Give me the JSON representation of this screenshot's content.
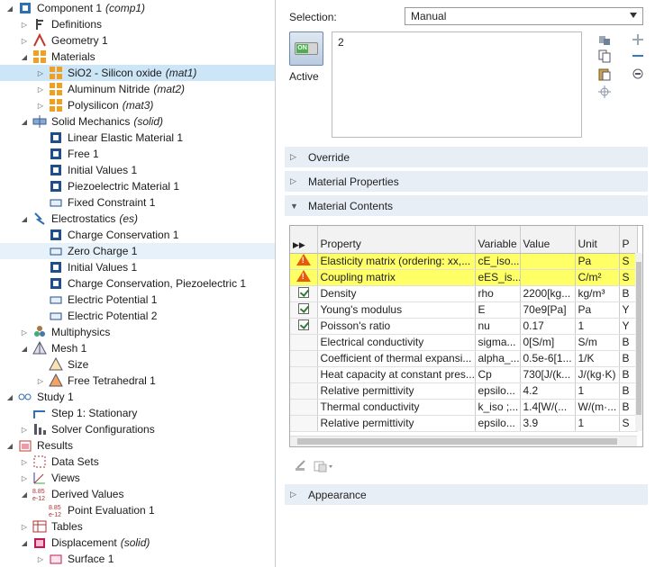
{
  "tree": {
    "items": [
      {
        "label": "Component 1",
        "suffix": "(comp1)",
        "indent": 0,
        "twisty": "open",
        "icon": "component-icon"
      },
      {
        "label": "Definitions",
        "suffix": "",
        "indent": 1,
        "twisty": "closed",
        "icon": "definitions-icon"
      },
      {
        "label": "Geometry 1",
        "suffix": "",
        "indent": 1,
        "twisty": "closed",
        "icon": "geometry-icon"
      },
      {
        "label": "Materials",
        "suffix": "",
        "indent": 1,
        "twisty": "open",
        "icon": "materials-icon"
      },
      {
        "label": "SiO2 - Silicon oxide",
        "suffix": "(mat1)",
        "indent": 2,
        "twisty": "closed",
        "icon": "material-icon",
        "selected": true
      },
      {
        "label": "Aluminum Nitride",
        "suffix": "(mat2)",
        "indent": 2,
        "twisty": "closed",
        "icon": "material-icon"
      },
      {
        "label": "Polysilicon",
        "suffix": "(mat3)",
        "indent": 2,
        "twisty": "closed",
        "icon": "material-icon"
      },
      {
        "label": "Solid Mechanics",
        "suffix": "(solid)",
        "indent": 1,
        "twisty": "open",
        "icon": "solid-mechanics-icon"
      },
      {
        "label": "Linear Elastic Material 1",
        "suffix": "",
        "indent": 2,
        "twisty": "none",
        "icon": "domain-feature-icon"
      },
      {
        "label": "Free 1",
        "suffix": "",
        "indent": 2,
        "twisty": "none",
        "icon": "domain-feature-icon"
      },
      {
        "label": "Initial Values 1",
        "suffix": "",
        "indent": 2,
        "twisty": "none",
        "icon": "domain-feature-icon"
      },
      {
        "label": "Piezoelectric Material 1",
        "suffix": "",
        "indent": 2,
        "twisty": "none",
        "icon": "domain-feature-icon"
      },
      {
        "label": "Fixed Constraint 1",
        "suffix": "",
        "indent": 2,
        "twisty": "none",
        "icon": "boundary-feature-icon"
      },
      {
        "label": "Electrostatics",
        "suffix": "(es)",
        "indent": 1,
        "twisty": "open",
        "icon": "electrostatics-icon"
      },
      {
        "label": "Charge Conservation 1",
        "suffix": "",
        "indent": 2,
        "twisty": "none",
        "icon": "domain-feature-icon"
      },
      {
        "label": "Zero Charge 1",
        "suffix": "",
        "indent": 2,
        "twisty": "none",
        "icon": "boundary-feature-icon",
        "alt": true
      },
      {
        "label": "Initial Values 1",
        "suffix": "",
        "indent": 2,
        "twisty": "none",
        "icon": "domain-feature-icon"
      },
      {
        "label": "Charge Conservation, Piezoelectric 1",
        "suffix": "",
        "indent": 2,
        "twisty": "none",
        "icon": "domain-feature-icon"
      },
      {
        "label": "Electric Potential 1",
        "suffix": "",
        "indent": 2,
        "twisty": "none",
        "icon": "boundary-feature-icon"
      },
      {
        "label": "Electric Potential 2",
        "suffix": "",
        "indent": 2,
        "twisty": "none",
        "icon": "boundary-feature-icon"
      },
      {
        "label": "Multiphysics",
        "suffix": "",
        "indent": 1,
        "twisty": "closed",
        "icon": "multiphysics-icon"
      },
      {
        "label": "Mesh 1",
        "suffix": "",
        "indent": 1,
        "twisty": "open",
        "icon": "mesh-icon"
      },
      {
        "label": "Size",
        "suffix": "",
        "indent": 2,
        "twisty": "none",
        "icon": "mesh-size-icon"
      },
      {
        "label": "Free Tetrahedral 1",
        "suffix": "",
        "indent": 2,
        "twisty": "closed",
        "icon": "free-tetrahedral-icon"
      },
      {
        "label": "Study 1",
        "suffix": "",
        "indent": 0,
        "twisty": "open",
        "icon": "study-icon"
      },
      {
        "label": "Step 1: Stationary",
        "suffix": "",
        "indent": 1,
        "twisty": "none",
        "icon": "stationary-step-icon"
      },
      {
        "label": "Solver Configurations",
        "suffix": "",
        "indent": 1,
        "twisty": "closed",
        "icon": "solver-icon"
      },
      {
        "label": "Results",
        "suffix": "",
        "indent": 0,
        "twisty": "open",
        "icon": "results-icon"
      },
      {
        "label": "Data Sets",
        "suffix": "",
        "indent": 1,
        "twisty": "closed",
        "icon": "datasets-icon"
      },
      {
        "label": "Views",
        "suffix": "",
        "indent": 1,
        "twisty": "closed",
        "icon": "views-icon"
      },
      {
        "label": "Derived Values",
        "suffix": "",
        "indent": 1,
        "twisty": "open",
        "icon": "derived-values-icon"
      },
      {
        "label": "Point Evaluation 1",
        "suffix": "",
        "indent": 2,
        "twisty": "none",
        "icon": "point-evaluation-icon"
      },
      {
        "label": "Tables",
        "suffix": "",
        "indent": 1,
        "twisty": "closed",
        "icon": "tables-icon"
      },
      {
        "label": "Displacement",
        "suffix": "(solid)",
        "indent": 1,
        "twisty": "open",
        "icon": "plot-group-icon"
      },
      {
        "label": "Surface 1",
        "suffix": "",
        "indent": 2,
        "twisty": "closed",
        "icon": "surface-plot-icon"
      }
    ]
  },
  "settings": {
    "selection_label": "Selection:",
    "selection_value": "Manual",
    "active_label": "Active",
    "active_toggle": "ON",
    "selection_list": [
      "2"
    ],
    "sections": {
      "override": "Override",
      "material_properties": "Material Properties",
      "material_contents": "Material Contents",
      "appearance": "Appearance"
    },
    "table": {
      "headers": [
        "",
        "Property",
        "Variable",
        "Value",
        "Unit",
        "P"
      ],
      "rows": [
        {
          "status": "warning",
          "property": "Elasticity matrix (ordering: xx,...",
          "variable": "cE_iso...",
          "value": "",
          "unit": "Pa",
          "p": "S",
          "highlight": true
        },
        {
          "status": "warning",
          "property": "Coupling matrix",
          "variable": "eES_is...",
          "value": "",
          "unit": "C/m²",
          "p": "S",
          "highlight": true
        },
        {
          "status": "check",
          "property": "Density",
          "variable": "rho",
          "value": "2200[kg...",
          "unit": "kg/m³",
          "p": "B"
        },
        {
          "status": "check",
          "property": "Young's modulus",
          "variable": "E",
          "value": "70e9[Pa]",
          "unit": "Pa",
          "p": "Y"
        },
        {
          "status": "check",
          "property": "Poisson's ratio",
          "variable": "nu",
          "value": "0.17",
          "unit": "1",
          "p": "Y"
        },
        {
          "status": "",
          "property": "Electrical conductivity",
          "variable": "sigma...",
          "value": "0[S/m]",
          "unit": "S/m",
          "p": "B"
        },
        {
          "status": "",
          "property": "Coefficient of thermal expansi...",
          "variable": "alpha_...",
          "value": "0.5e-6[1...",
          "unit": "1/K",
          "p": "B"
        },
        {
          "status": "",
          "property": "Heat capacity at constant pres...",
          "variable": "Cp",
          "value": "730[J/(k...",
          "unit": "J/(kg·K)",
          "p": "B"
        },
        {
          "status": "",
          "property": "Relative permittivity",
          "variable": "epsilo...",
          "value": "4.2",
          "unit": "1",
          "p": "B"
        },
        {
          "status": "",
          "property": "Thermal conductivity",
          "variable": "k_iso ;...",
          "value": "1.4[W/(...",
          "unit": "W/(m·...",
          "p": "B"
        },
        {
          "status": "",
          "property": "Relative permittivity",
          "variable": "epsilo...",
          "value": "3.9",
          "unit": "1",
          "p": "S"
        }
      ]
    }
  }
}
